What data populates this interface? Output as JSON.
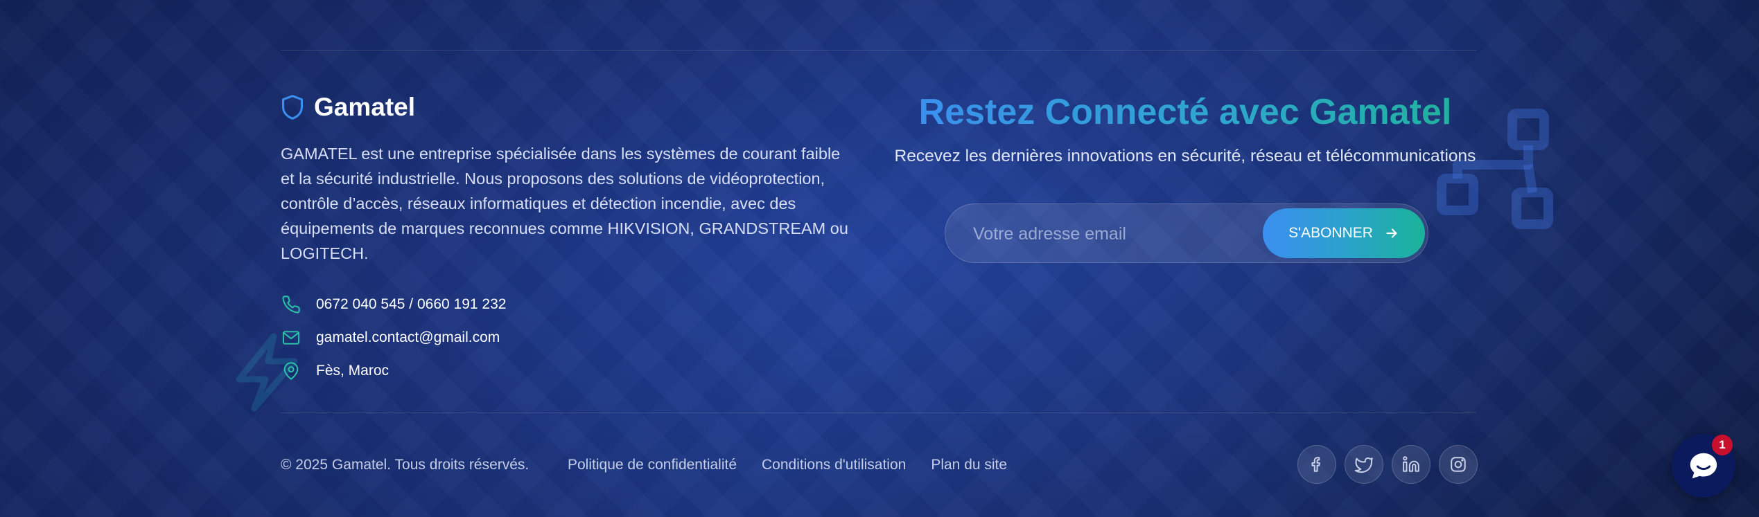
{
  "brand": {
    "name": "Gamatel",
    "icon": "shield-icon",
    "description": "GAMATEL est une entreprise spécialisée dans les systèmes de courant faible et la sécurité industrielle. Nous proposons des solutions de vidéoprotection, contrôle d’accès, réseaux informatiques et détection incendie, avec des équipements de marques reconnues comme HIKVISION, GRANDSTREAM ou LOGITECH."
  },
  "contact": {
    "phone": "0672 040 545 / 0660 191 232",
    "email": "gamatel.contact@gmail.com",
    "location": "Fès, Maroc"
  },
  "newsletter": {
    "title": "Restez Connecté avec Gamatel",
    "subtitle": "Recevez les dernières innovations en sécurité, réseau et télécommunications",
    "email_placeholder": "Votre adresse email",
    "subscribe_label": "S'ABONNER"
  },
  "footer": {
    "copyright": "© 2025 Gamatel. Tous droits réservés.",
    "links": [
      "Politique de confidentialité",
      "Conditions d'utilisation",
      "Plan du site"
    ],
    "socials": [
      "facebook-icon",
      "twitter-icon",
      "linkedin-icon",
      "instagram-icon"
    ]
  },
  "chat": {
    "badge_count": "1"
  },
  "colors": {
    "accent_blue": "#3b8ff0",
    "accent_teal": "#1fb39a",
    "icon_teal": "#2bbfa6",
    "badge_red": "#c8102e"
  }
}
